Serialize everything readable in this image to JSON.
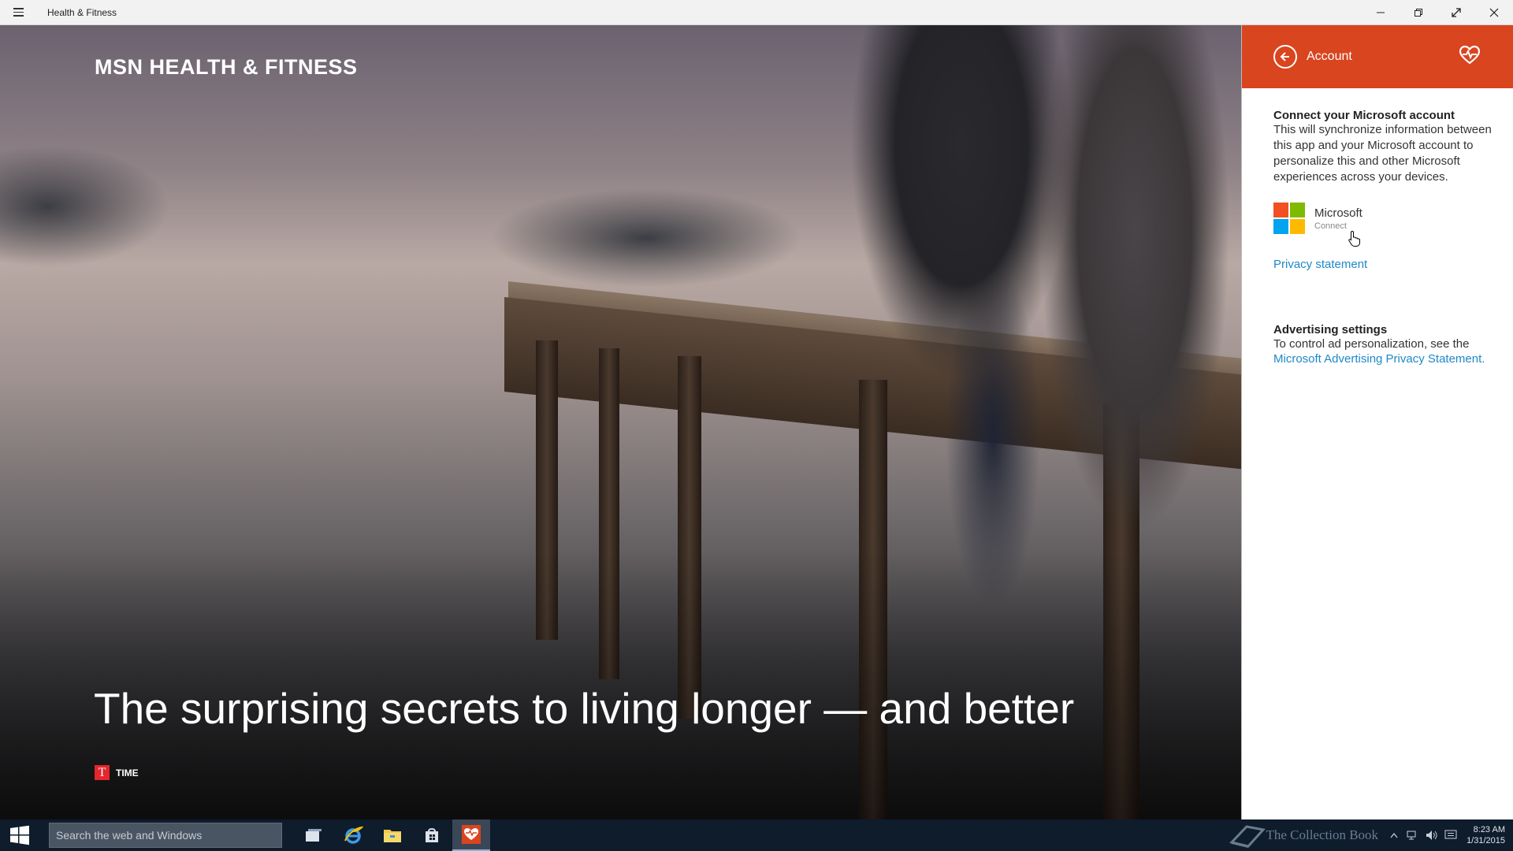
{
  "window": {
    "title": "Health & Fitness"
  },
  "hero": {
    "brand": "MSN HEALTH & FITNESS",
    "headline": "The surprising secrets to living longer — and better",
    "source_logo": "T",
    "source_name": "TIME"
  },
  "panel": {
    "title": "Account",
    "connect": {
      "heading": "Connect your Microsoft account",
      "text": "This will synchronize information between this app and your Microsoft account to personalize this and other Microsoft experiences across your devices."
    },
    "account": {
      "name": "Microsoft",
      "status": "Connect"
    },
    "privacy_link": "Privacy statement",
    "advertising": {
      "heading": "Advertising settings",
      "text": "To control ad personalization, see the",
      "link": "Microsoft Advertising Privacy Statement."
    }
  },
  "taskbar": {
    "search_placeholder": "Search the web and Windows",
    "watermark": "The Collection Book",
    "clock_time": "8:23 AM",
    "clock_date": "1/31/2015"
  },
  "colors": {
    "accent": "#d9451f",
    "link": "#1e88c7",
    "taskbar": "#0e1c2c",
    "ms_red": "#f25022",
    "ms_green": "#7fba00",
    "ms_blue": "#00a4ef",
    "ms_yellow": "#ffb900"
  },
  "icons": {
    "menu": "hamburger-icon",
    "minimize": "minimize-icon",
    "restore": "restore-icon",
    "fullscreen": "fullscreen-icon",
    "close": "close-icon",
    "back": "back-arrow-icon",
    "app": "heart-pulse-icon"
  }
}
